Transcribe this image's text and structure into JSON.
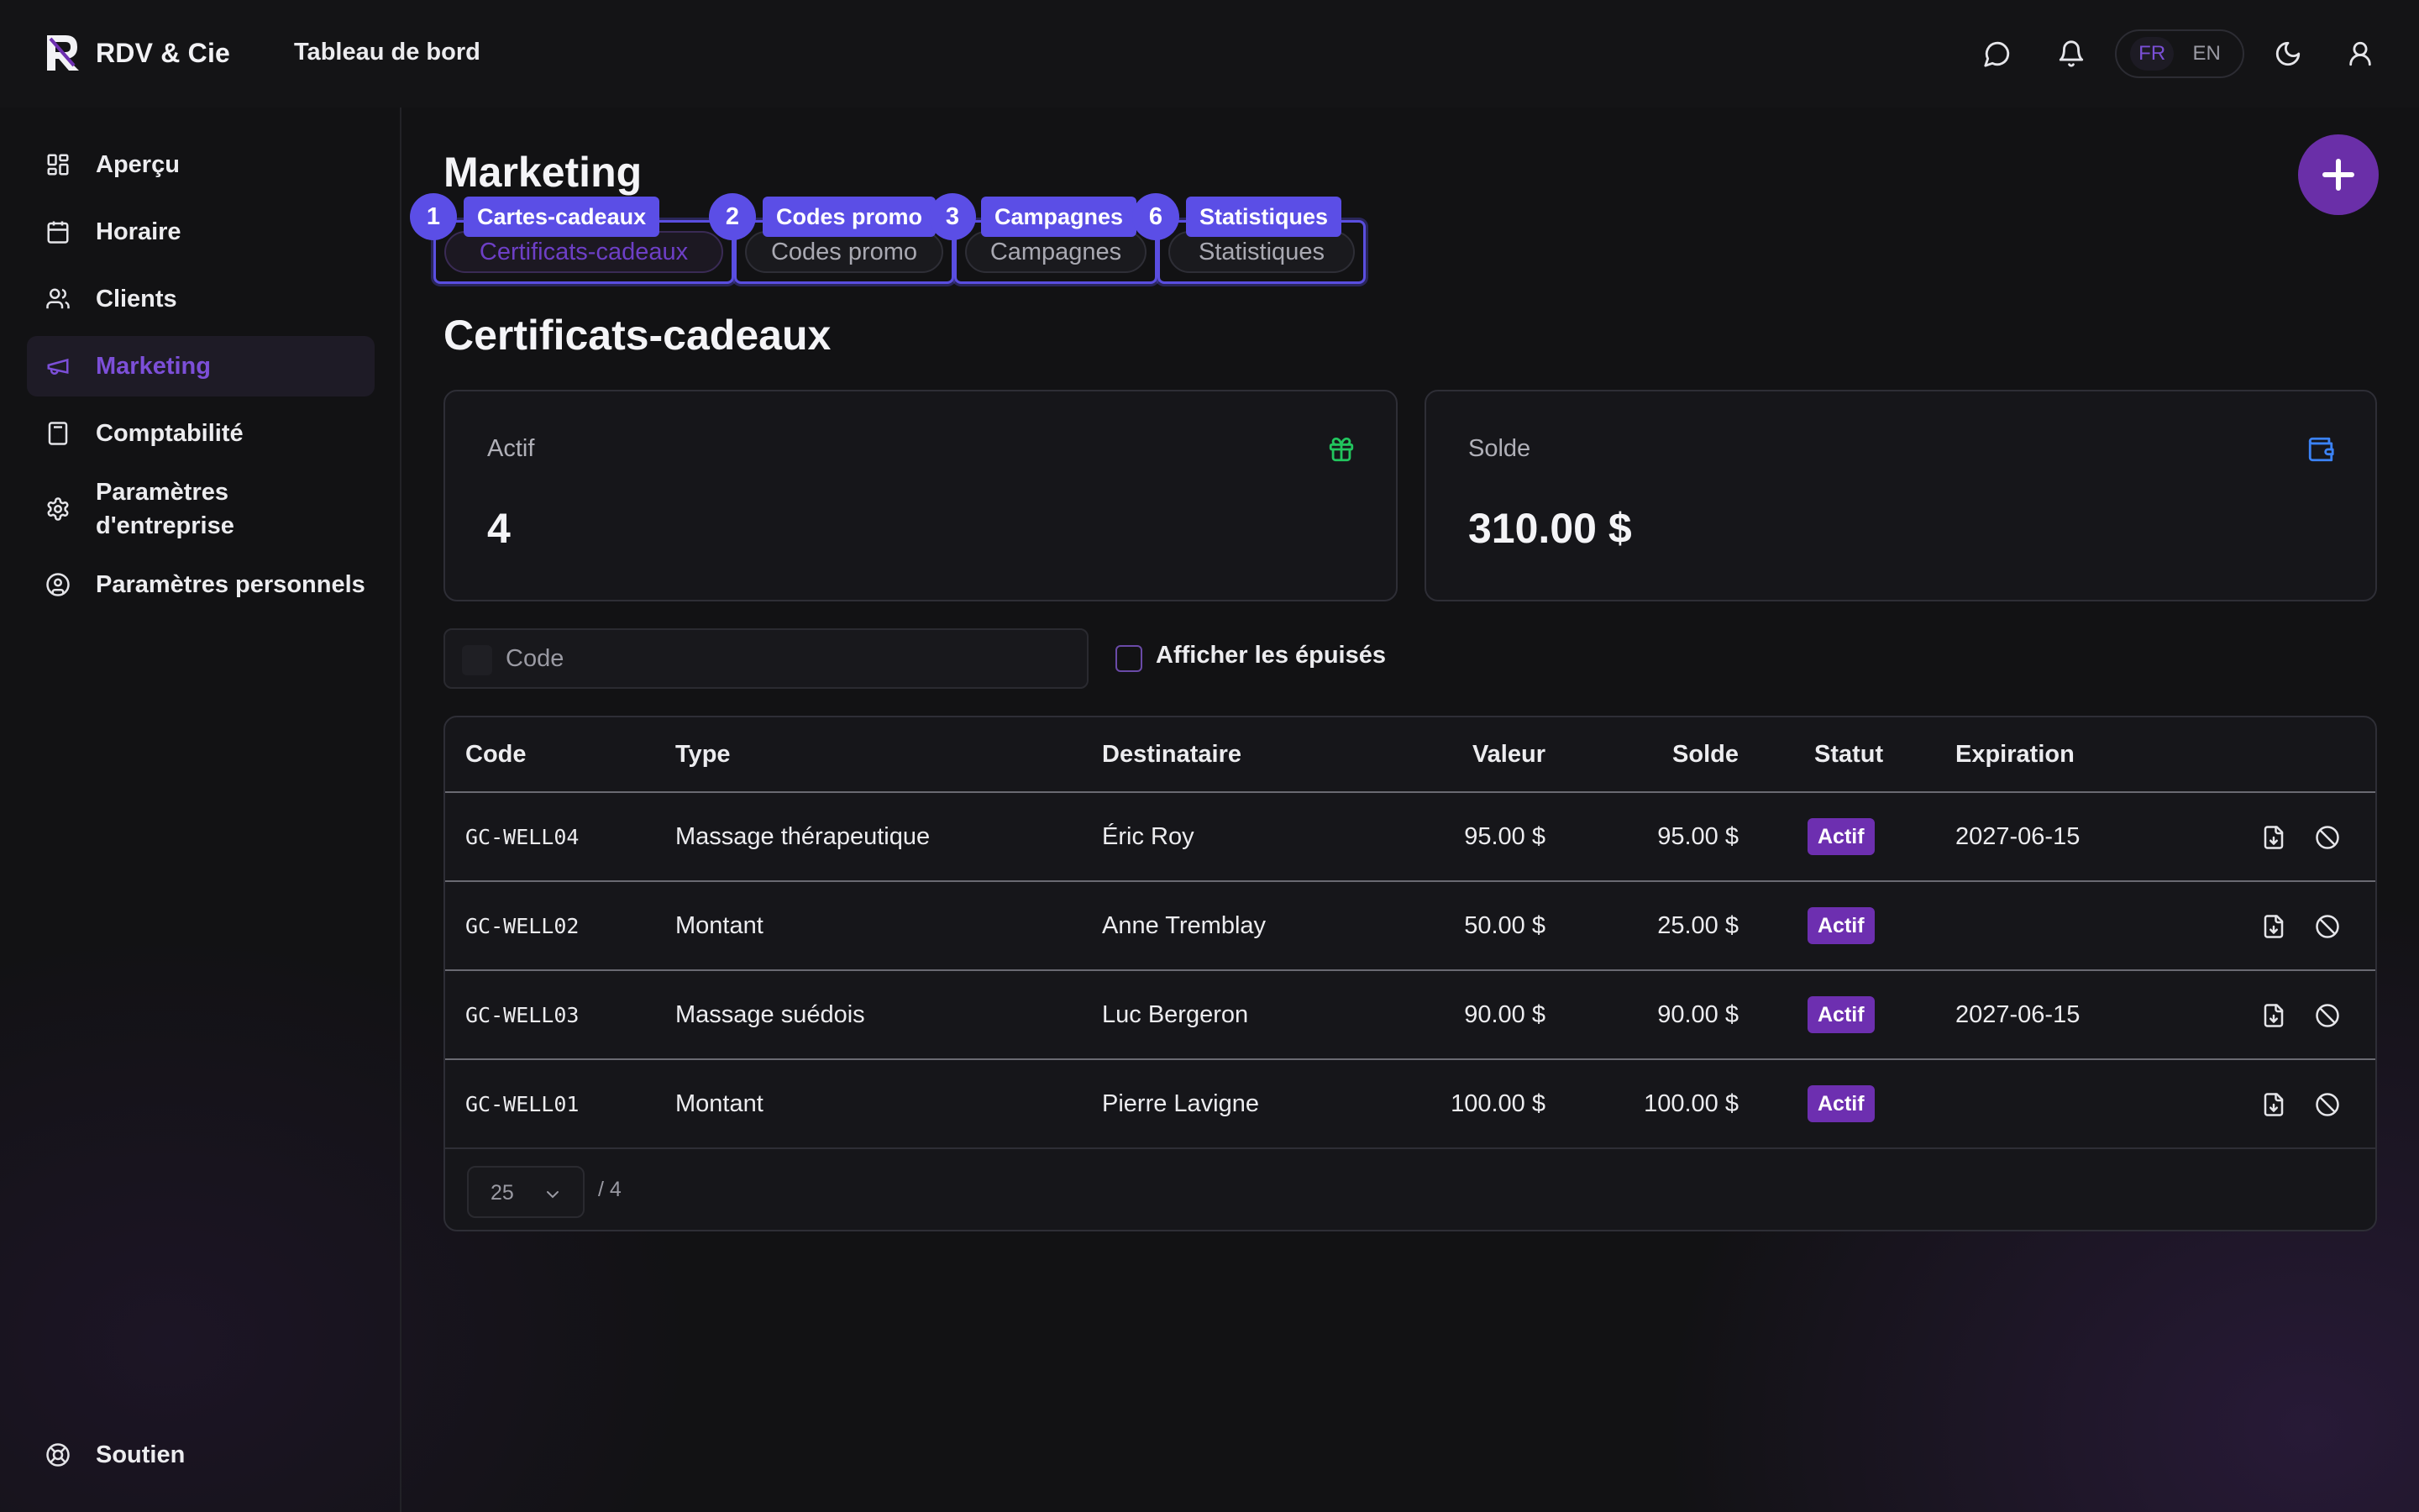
{
  "app": {
    "name": "RDV & Cie",
    "header_title": "Tableau de bord"
  },
  "language": {
    "active": "FR",
    "inactive": "EN"
  },
  "sidebar": {
    "items": [
      {
        "label": "Aperçu",
        "icon": "grid-icon"
      },
      {
        "label": "Horaire",
        "icon": "calendar-icon"
      },
      {
        "label": "Clients",
        "icon": "users-icon"
      },
      {
        "label": "Marketing",
        "icon": "megaphone-icon",
        "active": true
      },
      {
        "label": "Comptabilité",
        "icon": "calculator-icon"
      },
      {
        "label": "Paramètres\nd'entreprise",
        "icon": "gear-icon"
      },
      {
        "label": "Paramètres personnels",
        "icon": "user-circle-icon"
      }
    ],
    "footer": {
      "label": "Soutien",
      "icon": "lifebuoy-icon"
    }
  },
  "page": {
    "title": "Marketing"
  },
  "tabs": [
    {
      "label": "Certificats-cadeaux",
      "active": true
    },
    {
      "label": "Codes promo"
    },
    {
      "label": "Campagnes"
    },
    {
      "label": "Statistiques"
    }
  ],
  "overlay_marks": [
    {
      "num": "1",
      "label": "Cartes-cadeaux"
    },
    {
      "num": "2",
      "label": "Codes promo"
    },
    {
      "num": "3",
      "label": "Campagnes"
    },
    {
      "num": "6",
      "label": "Statistiques"
    }
  ],
  "section": {
    "title": "Certificats-cadeaux"
  },
  "cards": {
    "active": {
      "label": "Actif",
      "value": "4",
      "icon": "gift-icon"
    },
    "balance": {
      "label": "Solde",
      "value": "310.00 $",
      "icon": "wallet-icon"
    }
  },
  "filters": {
    "search_placeholder": "Code",
    "show_depleted_label": "Afficher les épuisés"
  },
  "table": {
    "headers": [
      "Code",
      "Type",
      "Destinataire",
      "Valeur",
      "Solde",
      "Statut",
      "Expiration"
    ],
    "rows": [
      {
        "code": "GC-WELL04",
        "type": "Massage thérapeutique",
        "recipient": "Éric Roy",
        "value": "95.00 $",
        "balance": "95.00 $",
        "status": "Actif",
        "expiration": "2027-06-15"
      },
      {
        "code": "GC-WELL02",
        "type": "Montant",
        "recipient": "Anne Tremblay",
        "value": "50.00 $",
        "balance": "25.00 $",
        "status": "Actif",
        "expiration": ""
      },
      {
        "code": "GC-WELL03",
        "type": "Massage suédois",
        "recipient": "Luc Bergeron",
        "value": "90.00 $",
        "balance": "90.00 $",
        "status": "Actif",
        "expiration": "2027-06-15"
      },
      {
        "code": "GC-WELL01",
        "type": "Montant",
        "recipient": "Pierre Lavigne",
        "value": "100.00 $",
        "balance": "100.00 $",
        "status": "Actif",
        "expiration": ""
      }
    ],
    "page_size": "25",
    "total": "/ 4"
  },
  "colors": {
    "accent": "#6d2fb0",
    "overlay": "#5b4ee6",
    "gift_icon": "#22c55e",
    "wallet_icon": "#3b82f6"
  }
}
